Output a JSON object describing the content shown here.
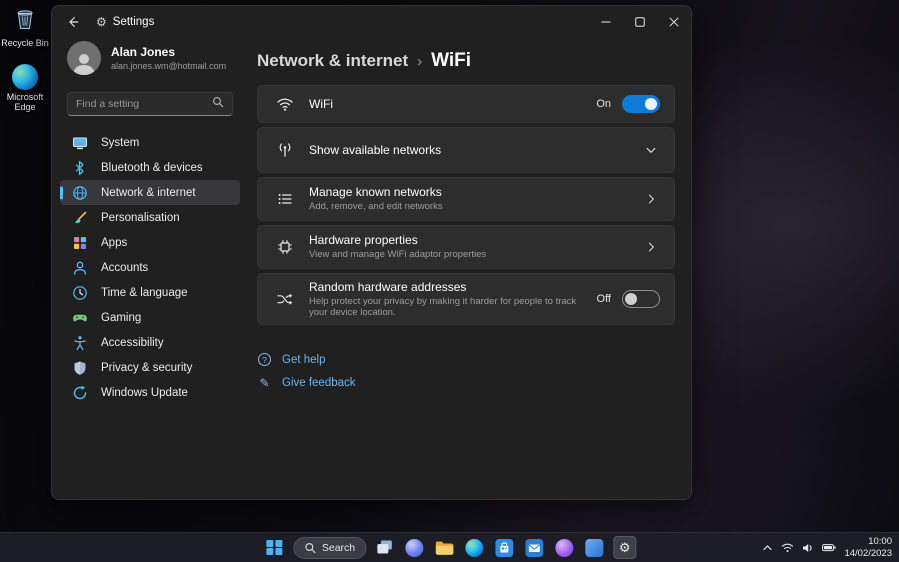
{
  "desktop": {
    "icons": [
      {
        "label": "Recycle Bin"
      },
      {
        "label": "Microsoft Edge"
      }
    ]
  },
  "window": {
    "title": "Settings"
  },
  "sidebar": {
    "user": {
      "name": "Alan Jones",
      "email": "alan.jones.wm@hotmail.com"
    },
    "search": {
      "placeholder": "Find a setting"
    },
    "selected_index": 2,
    "items": [
      {
        "label": "System"
      },
      {
        "label": "Bluetooth & devices"
      },
      {
        "label": "Network & internet"
      },
      {
        "label": "Personalisation"
      },
      {
        "label": "Apps"
      },
      {
        "label": "Accounts"
      },
      {
        "label": "Time & language"
      },
      {
        "label": "Gaming"
      },
      {
        "label": "Accessibility"
      },
      {
        "label": "Privacy & security"
      },
      {
        "label": "Windows Update"
      }
    ]
  },
  "main": {
    "breadcrumb": {
      "parent": "Network & internet",
      "separator": "›",
      "current": "WiFi"
    },
    "cards": [
      {
        "title": "WiFi",
        "toggle_label": "On",
        "toggle_on": true
      },
      {
        "title": "Show available networks"
      },
      {
        "title": "Manage known networks",
        "subtitle": "Add, remove, and edit networks"
      },
      {
        "title": "Hardware properties",
        "subtitle": "View and manage WiFi adaptor properties"
      },
      {
        "title": "Random hardware addresses",
        "subtitle": "Help protect your privacy by making it harder for people to track your device location.",
        "toggle_label": "Off",
        "toggle_on": false
      }
    ],
    "links": [
      {
        "label": "Get help"
      },
      {
        "label": "Give feedback"
      }
    ]
  },
  "taskbar": {
    "search_label": "Search",
    "apps": [
      "task-view",
      "chat",
      "file-explorer",
      "edge",
      "store",
      "mail",
      "pinned-app-purple",
      "pinned-app-blue",
      "settings"
    ],
    "tray": {
      "time": "10:00",
      "date": "14/02/2023"
    }
  },
  "colors": {
    "accent": "#4cc2ff",
    "toggle_on": "#0f7bd7",
    "window_bg": "#202020",
    "card_bg": "#2d2d2d",
    "sidebar_selected": "#37373c",
    "link": "#6cb6f0"
  }
}
